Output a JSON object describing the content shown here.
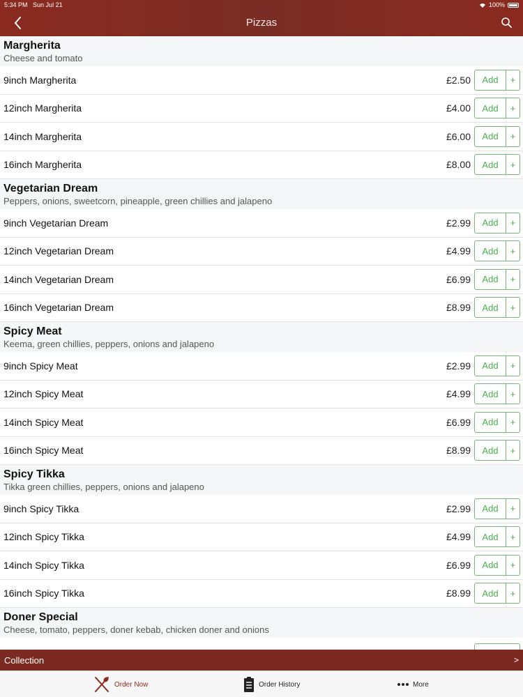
{
  "status": {
    "time": "5:34 PM",
    "date": "Sun Jul 21",
    "battery": "100%"
  },
  "nav": {
    "title": "Pizzas"
  },
  "labels": {
    "add": "Add",
    "plus": "+"
  },
  "sections": [
    {
      "title": "Margherita",
      "desc": "Cheese and tomato",
      "items": [
        {
          "name": "9inch Margherita",
          "price": "£2.50"
        },
        {
          "name": "12inch Margherita",
          "price": "£4.00"
        },
        {
          "name": "14inch Margherita",
          "price": "£6.00"
        },
        {
          "name": "16inch Margherita",
          "price": "£8.00"
        }
      ]
    },
    {
      "title": "Vegetarian Dream",
      "desc": "Peppers, onions, sweetcorn, pineapple, green chillies and jalapeno",
      "items": [
        {
          "name": "9inch Vegetarian Dream",
          "price": "£2.99"
        },
        {
          "name": "12inch Vegetarian Dream",
          "price": "£4.99"
        },
        {
          "name": "14inch Vegetarian Dream",
          "price": "£6.99"
        },
        {
          "name": "16inch Vegetarian Dream",
          "price": "£8.99"
        }
      ]
    },
    {
      "title": "Spicy Meat",
      "desc": "Keema, green chillies, peppers, onions and jalapeno",
      "items": [
        {
          "name": "9inch Spicy Meat",
          "price": "£2.99"
        },
        {
          "name": "12inch Spicy Meat",
          "price": "£4.99"
        },
        {
          "name": "14inch Spicy Meat",
          "price": "£6.99"
        },
        {
          "name": "16inch Spicy Meat",
          "price": "£8.99"
        }
      ]
    },
    {
      "title": "Spicy Tikka",
      "desc": "Tikka green chillies, peppers, onions and jalapeno",
      "items": [
        {
          "name": "9inch Spicy Tikka",
          "price": "£2.99"
        },
        {
          "name": "12inch Spicy Tikka",
          "price": "£4.99"
        },
        {
          "name": "14inch Spicy Tikka",
          "price": "£6.99"
        },
        {
          "name": "16inch Spicy Tikka",
          "price": "£8.99"
        }
      ]
    },
    {
      "title": "Doner Special",
      "desc": "Cheese, tomato, peppers, doner kebab, chicken doner and onions",
      "items": []
    }
  ],
  "collection": {
    "label": "Collection",
    "chevron": ">"
  },
  "tabs": {
    "order_now": "Order Now",
    "order_history": "Order History",
    "more": "More"
  },
  "colors": {
    "brand": "#7c2a21",
    "accent_green": "#4caf50"
  },
  "icons": {
    "back": "chevron-left-icon",
    "search": "search-icon",
    "order_now": "fork-knife-icon",
    "order_history": "clipboard-icon",
    "more": "ellipsis-icon"
  }
}
